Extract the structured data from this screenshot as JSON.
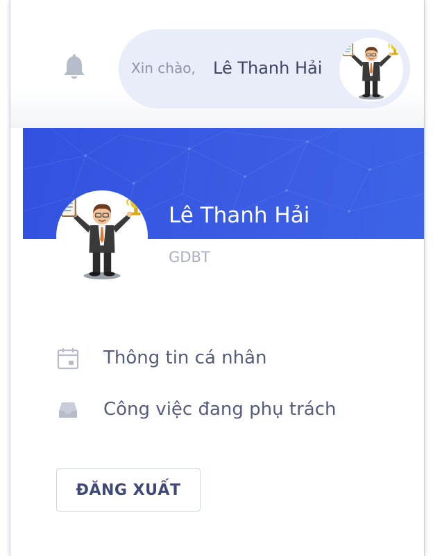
{
  "header": {
    "greeting_label": "Xin chào,",
    "user_name": "Lê Thanh Hải",
    "notification_icon": "bell-icon"
  },
  "profile": {
    "name": "Lê Thanh Hải",
    "role": "GDBT",
    "avatar_icon": "businessman-trophy-avatar"
  },
  "menu": {
    "items": [
      {
        "label": "Thông tin cá nhân",
        "icon": "calendar-icon"
      },
      {
        "label": "Công việc đang phụ trách",
        "icon": "inbox-tray-icon"
      }
    ]
  },
  "actions": {
    "logout_label": "ĐĂNG XUẤT"
  },
  "colors": {
    "banner": "#3152df",
    "pill": "#e9ecf9",
    "icon_gray": "#b7bccb",
    "text_dark": "#3f4663",
    "menu_text": "#555c7c"
  }
}
